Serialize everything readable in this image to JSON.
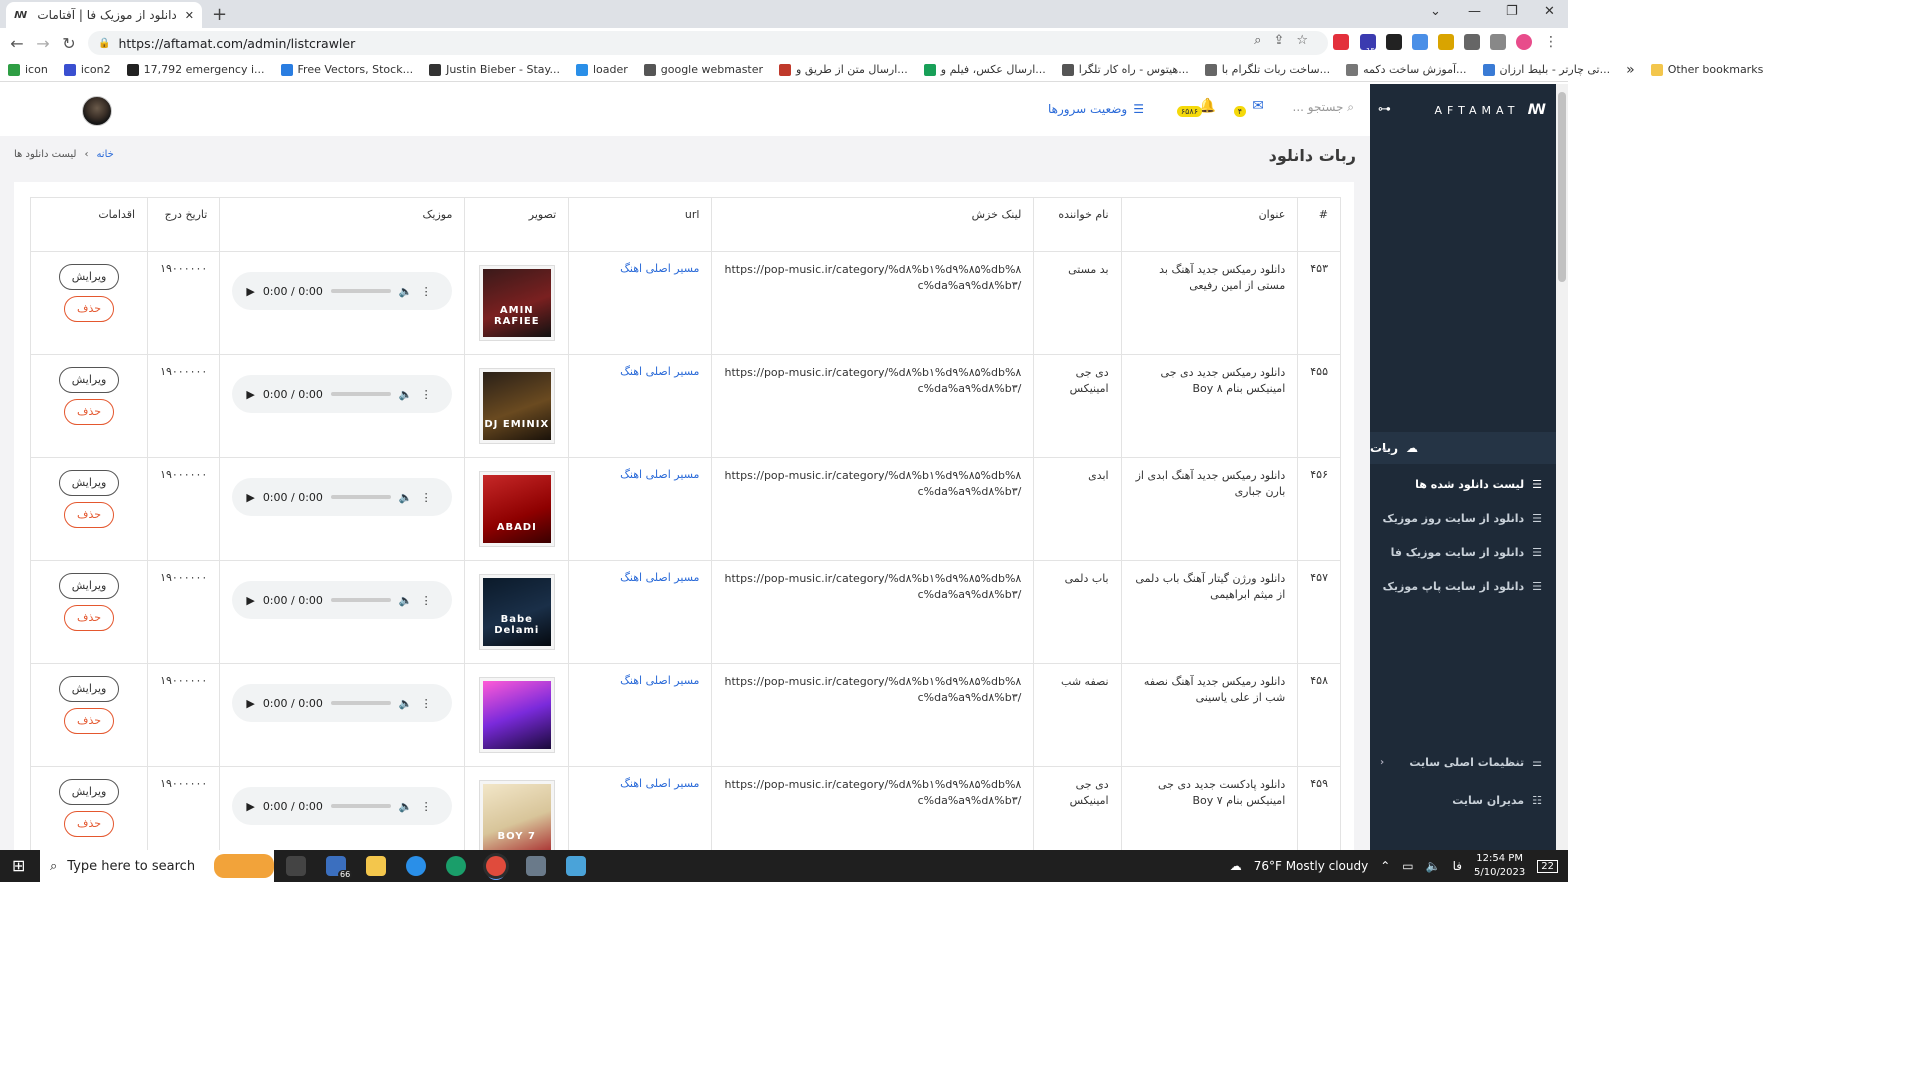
{
  "browser": {
    "tab_title": "دانلود از موزیک فا | آفتامات",
    "url": "https://aftamat.com/admin/listcrawler",
    "bookmarks": [
      "icon",
      "icon2",
      "17,792 emergency i...",
      "Free Vectors, Stock...",
      "Justin Bieber - Stay...",
      "loader",
      "google webmaster",
      "ارسال متن از طریق و...",
      "ارسال عکس، فیلم و...",
      "هیتوس - راه کار تلگرا...",
      "ساخت ربات تلگرام با...",
      "آموزش ساخت دکمه...",
      "تی چارتر - بلیط ارزان..."
    ],
    "other_bookmarks": "Other bookmarks",
    "extension_badge": "15"
  },
  "sidebar": {
    "logo_text": "AFTAMAT",
    "robot_section": "ربات",
    "items": [
      "لیست دانلود شده ها",
      "دانلود از سایت روز موزیک",
      "دانلود از سایت موزیک فا",
      "دانلود از سایت پاپ موزیک"
    ],
    "settings": "تنظیمات اصلی سایت",
    "admins": "مدیران سایت"
  },
  "topbar": {
    "search_placeholder": "جستجو ...",
    "mail_badge": "۴",
    "bell_badge": "۶۵۸۶",
    "server_status": "وضعیت سرورها"
  },
  "page": {
    "title": "ربات دانلود",
    "breadcrumb_home": "خانه",
    "breadcrumb_current": "لیست دانلود ها"
  },
  "table": {
    "headers": [
      "#",
      "عنوان",
      "نام خواننده",
      "لینک خزش",
      "url",
      "تصویر",
      "موزیک",
      "تاریخ درج",
      "اقدامات"
    ],
    "rows": [
      {
        "id": "۴۵۳",
        "title": "دانلود رمیکس جدید آهنگ بد مستی از امین رفیعی",
        "artist": "بد مستی",
        "crawl": "https://pop-music.ir/category/%d۸%b۱%d۹%۸۵%db%۸c%da%a۹%d۸%b۳/",
        "url": "مسیر اصلی اهنگ",
        "img": "AMIN RAFIEE",
        "date": "۱۹۰۰۰۰۰۰",
        "time": "0:00 / 0:00"
      },
      {
        "id": "۴۵۵",
        "title": "دانلود رمیکس جدید دی جی امینیکس بنام Boy ۸",
        "artist": "دی جی امینیکس",
        "crawl": "https://pop-music.ir/category/%d۸%b۱%d۹%۸۵%db%۸c%da%a۹%d۸%b۳/",
        "url": "مسیر اصلی اهنگ",
        "img": "DJ EMINIX",
        "date": "۱۹۰۰۰۰۰۰",
        "time": "0:00 / 0:00"
      },
      {
        "id": "۴۵۶",
        "title": "دانلود رمیکس جدید آهنگ ابدی از بارن جباری",
        "artist": "ابدی",
        "crawl": "https://pop-music.ir/category/%d۸%b۱%d۹%۸۵%db%۸c%da%a۹%d۸%b۳/",
        "url": "مسیر اصلی اهنگ",
        "img": "ABADI",
        "date": "۱۹۰۰۰۰۰۰",
        "time": "0:00 / 0:00"
      },
      {
        "id": "۴۵۷",
        "title": "دانلود ورژن گیتار آهنگ باب دلمی از میثم ابراهیمی",
        "artist": "باب دلمی",
        "crawl": "https://pop-music.ir/category/%d۸%b۱%d۹%۸۵%db%۸c%da%a۹%d۸%b۳/",
        "url": "مسیر اصلی اهنگ",
        "img": "Babe Delami",
        "date": "۱۹۰۰۰۰۰۰",
        "time": "0:00 / 0:00"
      },
      {
        "id": "۴۵۸",
        "title": "دانلود رمیکس جدید آهنگ نصفه شب از علی یاسینی",
        "artist": "نصفه شب",
        "crawl": "https://pop-music.ir/category/%d۸%b۱%d۹%۸۵%db%۸c%da%a۹%d۸%b۳/",
        "url": "مسیر اصلی اهنگ",
        "img": "",
        "date": "۱۹۰۰۰۰۰۰",
        "time": "0:00 / 0:00"
      },
      {
        "id": "۴۵۹",
        "title": "دانلود پادکست جدید دی جی امینیکس بنام Boy ۷",
        "artist": "دی جی امینیکس",
        "crawl": "https://pop-music.ir/category/%d۸%b۱%d۹%۸۵%db%۸c%da%a۹%d۸%b۳/",
        "url": "مسیر اصلی اهنگ",
        "img": "BOY 7",
        "date": "۱۹۰۰۰۰۰۰",
        "time": "0:00 / 0:00"
      }
    ],
    "edit_label": "ویرایش",
    "delete_label": "حذف"
  },
  "taskbar": {
    "search_placeholder": "Type here to search",
    "mail_count": "66",
    "weather": "76°F  Mostly cloudy",
    "lang": "فا",
    "time": "12:54 PM",
    "date": "5/10/2023",
    "notif": "22"
  },
  "colors": {
    "accent": "#2a6ad8",
    "sidebar": "#1e2a38",
    "danger": "#e4572e"
  }
}
